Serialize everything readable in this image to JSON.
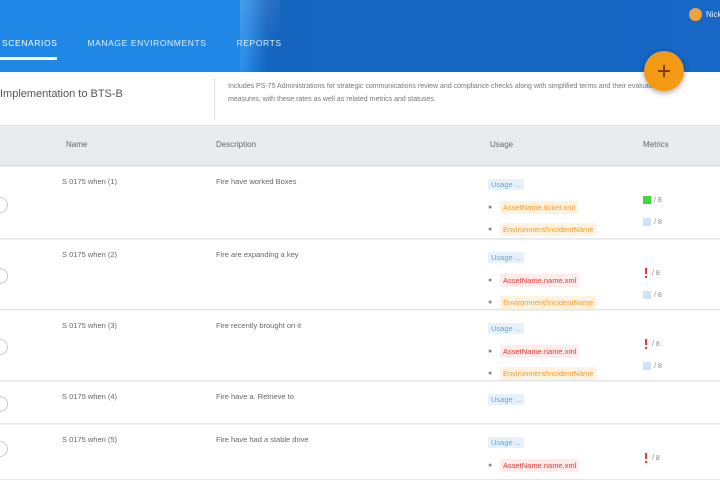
{
  "header": {
    "tabs": [
      "Scenarios",
      "Manage Environments",
      "Reports"
    ],
    "user_name": "Nick"
  },
  "info": {
    "title": "Implementation to BTS-B",
    "description": "Includes PS-75 Administrations for strategic communications review and compliance checks along with simplified terms and their evaluation measures, with these rates as well as related metrics and statuses."
  },
  "table": {
    "headers": [
      "Name",
      "Description",
      "Usage",
      "Metrics"
    ],
    "rows": [
      {
        "name": "S 0175 when (1)",
        "description": "Fire have worked Boxes",
        "usage_link": "Usage ...",
        "items": [
          {
            "label": "AssetName.ticket.xml",
            "color": "orange"
          },
          {
            "label": "Environment/IncidentName",
            "color": "orange"
          }
        ],
        "metrics": [
          {
            "kind": "green",
            "value": "/ 8"
          },
          {
            "kind": "light",
            "value": "/ 8"
          }
        ]
      },
      {
        "name": "S 0175 when (2)",
        "description": "Fire are expanding a key",
        "usage_link": "Usage ...",
        "items": [
          {
            "label": "AssetName.name.xml",
            "color": "red"
          },
          {
            "label": "Environment/IncidentName",
            "color": "orange"
          }
        ],
        "metrics": [
          {
            "kind": "red",
            "value": "/ 8"
          },
          {
            "kind": "light",
            "value": "/ 8"
          }
        ]
      },
      {
        "name": "S 0175 when (3)",
        "description": "Fire recently brought on it",
        "usage_link": "Usage ...",
        "items": [
          {
            "label": "AssetName.name.xml",
            "color": "red"
          },
          {
            "label": "Environment/IncidentName",
            "color": "orange"
          }
        ],
        "metrics": [
          {
            "kind": "red",
            "value": "/ 8"
          },
          {
            "kind": "light",
            "value": "/ 8"
          }
        ]
      },
      {
        "name": "S 0175 when (4)",
        "description": "Fire have a. Retrieve to",
        "usage_link": "Usage ...",
        "items": [],
        "metrics": []
      },
      {
        "name": "S 0175 when (5)",
        "description": "Fire have had a stable drive",
        "usage_link": "Usage ...",
        "items": [
          {
            "label": "AssetName.name.xml",
            "color": "red"
          }
        ],
        "metrics": [
          {
            "kind": "red",
            "value": "/ 8"
          }
        ]
      }
    ]
  },
  "colors": {
    "header_blue": "#1f87e6",
    "accent_orange": "#f39a15",
    "tag_orange": "#f29a2e",
    "tag_red": "#e53935",
    "metric_green": "#3dd63d"
  },
  "icons": {
    "fab": "plus-icon",
    "row_select": "radio-circle-icon"
  }
}
